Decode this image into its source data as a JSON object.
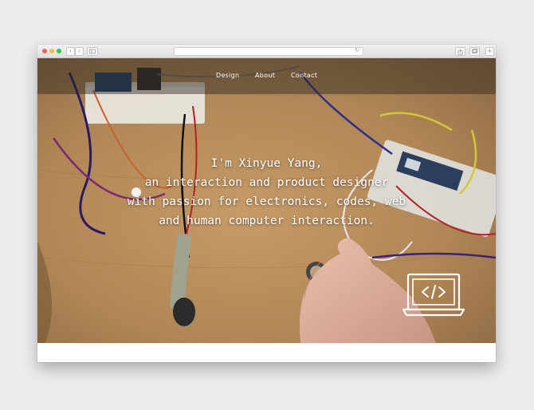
{
  "browser": {
    "traffic_lights": [
      "close",
      "minimize",
      "zoom"
    ],
    "nav_back": "‹",
    "nav_forward": "›",
    "address": "",
    "reload_glyph": "↻"
  },
  "nav": {
    "items": [
      {
        "label": "Design"
      },
      {
        "label": "About"
      },
      {
        "label": "Contact"
      }
    ]
  },
  "hero": {
    "lines": [
      "I'm Xinyue Yang,",
      "an interaction and product designer",
      "with passion for electronics, codes, web",
      "and human computer interaction."
    ]
  },
  "icons": {
    "code_laptop": "laptop-code-icon"
  },
  "colors": {
    "table": "#b48d5e",
    "nav_overlay": "rgba(45,38,32,0.45)",
    "text": "#ffffff"
  }
}
